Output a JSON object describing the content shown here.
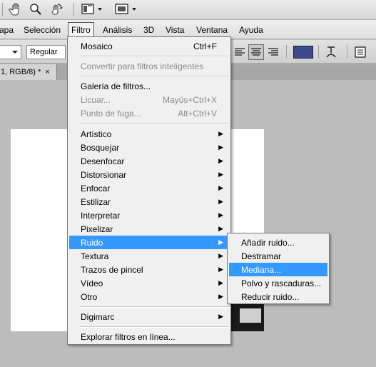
{
  "toolbar": {
    "icons": [
      "hand-tool-icon",
      "zoom-tool-icon",
      "rotate-view-icon",
      "arrange-documents-icon",
      "screen-mode-icon"
    ]
  },
  "menubar": {
    "items": [
      {
        "label": "apa"
      },
      {
        "label": "Selección"
      },
      {
        "label": "Filtro"
      },
      {
        "label": "Análisis"
      },
      {
        "label": "3D"
      },
      {
        "label": "Vista"
      },
      {
        "label": "Ventana"
      },
      {
        "label": "Ayuda"
      }
    ]
  },
  "options": {
    "font_style": "Regular",
    "swatch_color": "#3d4a8e"
  },
  "document": {
    "tab_title": "1, RGB/8) *",
    "tab_close": "×"
  },
  "filter_menu": {
    "items": [
      {
        "label": "Mosaico",
        "shortcut": "Ctrl+F"
      },
      {
        "label": "Convertir para filtros inteligentes"
      },
      {
        "label": "Galería de filtros..."
      },
      {
        "label": "Licuar...",
        "shortcut": "Mayús+Ctrl+X"
      },
      {
        "label": "Punto de fuga...",
        "shortcut": "Alt+Ctrl+V"
      },
      {
        "label": "Artístico"
      },
      {
        "label": "Bosquejar"
      },
      {
        "label": "Desenfocar"
      },
      {
        "label": "Distorsionar"
      },
      {
        "label": "Enfocar"
      },
      {
        "label": "Estilizar"
      },
      {
        "label": "Interpretar"
      },
      {
        "label": "Pixelizar"
      },
      {
        "label": "Ruido"
      },
      {
        "label": "Textura"
      },
      {
        "label": "Trazos de pincel"
      },
      {
        "label": "Vídeo"
      },
      {
        "label": "Otro"
      },
      {
        "label": "Digimarc"
      },
      {
        "label": "Explorar filtros en línea..."
      }
    ],
    "arrow": "▶"
  },
  "noise_submenu": {
    "items": [
      {
        "label": "Añadir ruido..."
      },
      {
        "label": "Destramar"
      },
      {
        "label": "Mediana..."
      },
      {
        "label": "Polvo y rascaduras..."
      },
      {
        "label": "Reducir ruido..."
      }
    ]
  }
}
